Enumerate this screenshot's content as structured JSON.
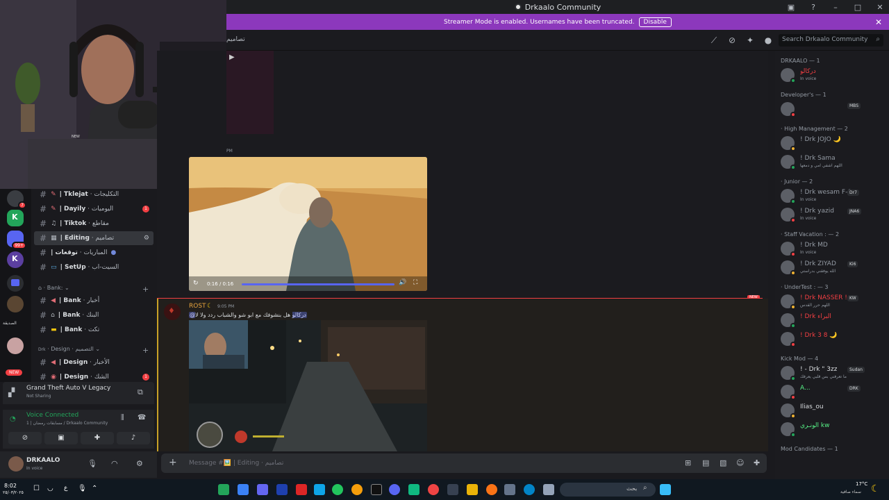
{
  "window": {
    "title": "Drkaalo Community"
  },
  "banner": {
    "text": "Streamer Mode is enabled. Usernames have been truncated.",
    "button": "Disable"
  },
  "header": {
    "channel_fragment": "تصاميم",
    "search_placeholder": "Search Drkaalo Community"
  },
  "webcam": {
    "shirt_label": "NEW"
  },
  "rail": {
    "badges": [
      "7",
      "99+"
    ],
    "new_pill": "NEW",
    "server_caption": "الصديقة"
  },
  "channels": [
    {
      "icon": "pencil-icon",
      "label": "| Tklejat",
      "suffix": "· التكليجات",
      "selected": false,
      "unread": ""
    },
    {
      "icon": "pin-icon",
      "label": "| Dayily",
      "suffix": "· اليوميات",
      "selected": false,
      "unread": "1"
    },
    {
      "icon": "note-icon",
      "label": "| Tiktok",
      "suffix": "· مقاطع",
      "selected": false,
      "unread": ""
    },
    {
      "icon": "image-icon",
      "label": "| Editing",
      "suffix": "· تصاميم",
      "selected": true,
      "unread": ""
    },
    {
      "icon": "ball-icon",
      "label": "| توقعات",
      "suffix": "· المباريات",
      "selected": false,
      "unread": ""
    },
    {
      "icon": "monitor-icon",
      "label": "| SetUp",
      "suffix": "· السيت-اب",
      "selected": false,
      "unread": ""
    }
  ],
  "cat_bank": "· Bank: ⌄",
  "bank_channels": [
    {
      "icon": "megaphone-icon",
      "label": "| Bank",
      "suffix": "· أخبار"
    },
    {
      "icon": "bank-icon",
      "label": "| Bank",
      "suffix": "· البنك"
    },
    {
      "icon": "ticket-icon",
      "label": "| Bank",
      "suffix": "· تكت"
    }
  ],
  "cat_design": "· Design · التصميم ⌄",
  "design_prefix": "Drk",
  "design_channels": [
    {
      "icon": "megaphone-icon",
      "label": "| Design",
      "suffix": "· الأخبار",
      "unread": ""
    },
    {
      "icon": "palette-icon",
      "label": "| Design",
      "suffix": "· الشك",
      "unread": "1"
    }
  ],
  "activity": {
    "title": "Grand Theft Auto V Legacy",
    "subtitle": "Not Sharing"
  },
  "voice": {
    "status": "Voice Connected",
    "channel": "1 | مسابقات رمضان / Drkaalo Community"
  },
  "user": {
    "name": "DRKAALO",
    "status": "In voice"
  },
  "chat": {
    "prev_time": "PM",
    "video_time": "0:16 / 0:16",
    "new_label": "NEW",
    "msg": {
      "author": "ROST",
      "time": "9:05 PM",
      "text": "هل بنشوفك مع ابو شو والشباب ردد ولا لا",
      "mention": "@دركالو"
    },
    "input_placeholder": "Message #🖼️ | Editing · تصاميم"
  },
  "members": {
    "groups": [
      {
        "title": "DRKAALO — 1",
        "items": [
          {
            "name": "دركالو",
            "color": "#f23f43",
            "status": "In voice",
            "tag": ""
          }
        ]
      },
      {
        "title": "Developer's — 1",
        "items": [
          {
            "name": "",
            "color": "#6b1d1d",
            "status": "",
            "tag": "MBS"
          }
        ]
      },
      {
        "title": "· High Management — 2",
        "items": [
          {
            "name": "! Drk JOJO 🌙",
            "color": "#949ba4",
            "status": "",
            "tag": ""
          },
          {
            "name": "! Drk Sama",
            "color": "#949ba4",
            "status": "اللهم اشفي امي و دمعها",
            "tag": ""
          }
        ]
      },
      {
        "title": "· Junior — 2",
        "items": [
          {
            "name": "! Drk wesam F-0",
            "color": "#949ba4",
            "status": "In voice",
            "tag": "Dr7"
          },
          {
            "name": "! Drk yazid",
            "color": "#949ba4",
            "status": "In voice",
            "tag": "JNA6"
          }
        ]
      },
      {
        "title": "· Staff Vacation : — 2",
        "items": [
          {
            "name": "! Drk MD",
            "color": "#949ba4",
            "status": "In voice",
            "tag": ""
          },
          {
            "name": "! Drk ZIYAD",
            "color": "#949ba4",
            "status": "الله يوفقني بدراستي",
            "tag": "Ki6"
          }
        ]
      },
      {
        "title": "· UnderTest : — 3",
        "items": [
          {
            "name": "! Drk NASSER ! ...",
            "color": "#f23f43",
            "status": "اللهم حرر القدس",
            "tag": "KW"
          },
          {
            "name": "! Drk البراء",
            "color": "#f23f43",
            "status": "",
            "tag": ""
          },
          {
            "name": "! Drk 3 8 🌙",
            "color": "#f23f43",
            "status": "",
            "tag": ""
          }
        ]
      },
      {
        "title": "Kick Mod — 4",
        "items": [
          {
            "name": "! - Drk \" 3zz",
            "color": "#dbdee1",
            "status": "ما تعرفني بس قلبي يعرفك",
            "tag": "Sudan"
          },
          {
            "name": "A...",
            "color": "#57f287",
            "status": "",
            "tag": "DRK"
          },
          {
            "name": "Ilias_ou",
            "color": "#dbdee1",
            "status": "",
            "tag": ""
          },
          {
            "name": "الونـري kw",
            "color": "#57f287",
            "status": "",
            "tag": ""
          }
        ]
      },
      {
        "title": "Mod Candidates — 1",
        "items": []
      }
    ]
  },
  "taskbar": {
    "time": "8:02",
    "date": "٢٥/٠٣/٢٠٢٥",
    "lang": "ع",
    "search": "بحث",
    "weather_temp": "17°C",
    "weather_desc": "سماء صافية"
  }
}
